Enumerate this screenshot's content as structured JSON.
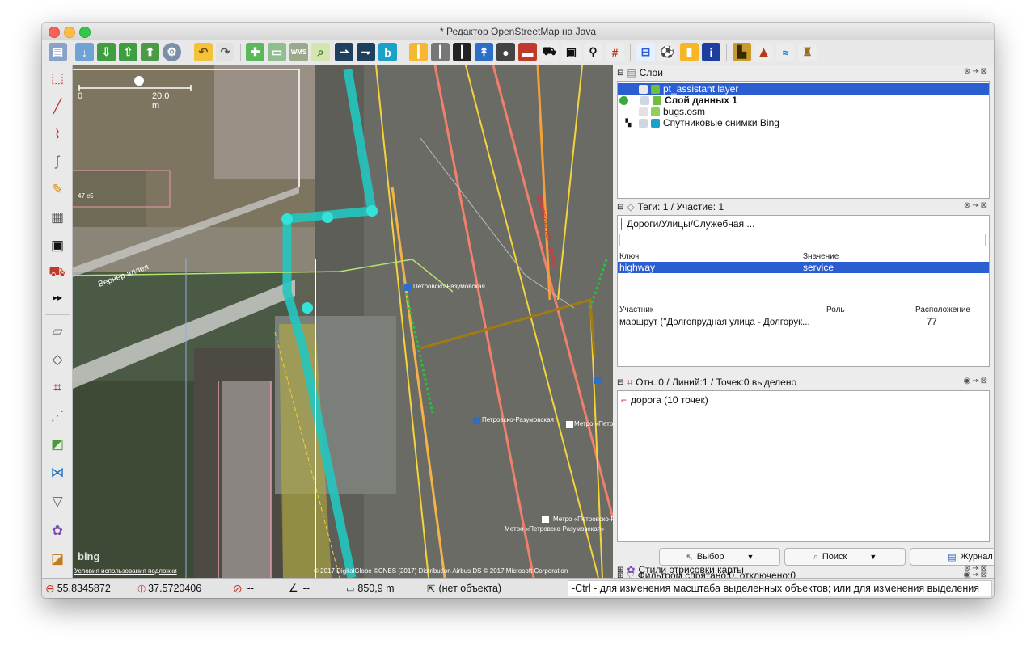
{
  "window": {
    "title": "* Редактор OpenStreetMap на Java"
  },
  "toolbar": {
    "icons": [
      "open-file",
      "save",
      "save-as",
      "upload",
      "download",
      "preferences",
      "undo",
      "redo",
      "zoom-in",
      "zoom-out",
      "wms",
      "search",
      "route-left",
      "route-right",
      "bing",
      "road-yellow",
      "road-grey",
      "road-black",
      "pt-stop",
      "traffic-light",
      "barrier",
      "car",
      "bus",
      "bicycle",
      "railway",
      "bed",
      "football",
      "beer",
      "info",
      "industrial",
      "mountain",
      "waterway",
      "castle"
    ]
  },
  "left_tools": {
    "icons": [
      "select",
      "draw-way",
      "draw-area",
      "improve-way",
      "pencil",
      "building",
      "bus",
      "pt-routing",
      "more",
      "layers",
      "tags",
      "relation-editor",
      "sidebar",
      "image-overlay",
      "map-paint",
      "filter",
      "palette",
      "chart"
    ]
  },
  "map": {
    "scale_label": "20,0 m",
    "scale_zero": "0",
    "labels": [
      {
        "key": "street1",
        "text": "Вернер аллея"
      },
      {
        "key": "street2",
        "text": "Дмитровское шоссе"
      },
      {
        "key": "stop1",
        "text": "Петровско-Разумовская"
      },
      {
        "key": "stop2",
        "text": "Петровско-Разумовская"
      },
      {
        "key": "metro1",
        "text": "Метро «Петр"
      },
      {
        "key": "metro2",
        "text": "Метро «Петровско-Разумовская»"
      },
      {
        "key": "metro3",
        "text": "Метро «Петровско-Разумовская»"
      },
      {
        "key": "num47",
        "text": "47 с5"
      }
    ],
    "terms": "Условия использования подложки",
    "attribution": "© 2017 DigitalGlobe ©CNES (2017) Distribution Airbus DS © 2017 Microsoft Corporation",
    "bing": "bing"
  },
  "layers_panel": {
    "title": "Слои",
    "items": [
      {
        "name": "pt_assistant layer",
        "selected": true
      },
      {
        "name": "Слой данных 1",
        "bold": true
      },
      {
        "name": "bugs.osm"
      },
      {
        "name": "Спутниковые снимки Bing"
      }
    ]
  },
  "tags_panel": {
    "title": "Теги: 1 / Участие: 1",
    "preset": "Дороги/Улицы/Служебная ...",
    "key_header": "Ключ",
    "value_header": "Значение",
    "rows": [
      {
        "key": "highway",
        "value": "service"
      }
    ],
    "member_header": "Участник",
    "role_header": "Роль",
    "position_header": "Расположение",
    "members": [
      {
        "name": "маршрут (\"Долгопрудная улица - Долгорук...",
        "role": "",
        "position": "77"
      }
    ]
  },
  "selection_panel": {
    "title": "Отн.:0 / Линий:1 / Точек:0 выделено",
    "items": [
      {
        "name": "дорога (10 точек)"
      }
    ],
    "buttons": {
      "select": "Выбор",
      "search": "Поиск",
      "history": "Журнал"
    }
  },
  "filter_panel": {
    "title": "Фильтром спрятано:0, отключено:0"
  },
  "styles_panel": {
    "title": "Стили отрисовки карты"
  },
  "statusbar": {
    "lat": "55.8345872",
    "lon": "37.5720406",
    "heading": "--",
    "angle": "--",
    "distance": "850,9 m",
    "object": "(нет объекта)",
    "hint": "-Ctrl - для изменения масштаба выделенных объектов; или для изменения выделения"
  },
  "colors": {
    "selection": "#2b5fd1",
    "pt_route": "#2ad4c8",
    "primary_road": "#f07f6b",
    "secondary_road": "#f4d43a"
  }
}
